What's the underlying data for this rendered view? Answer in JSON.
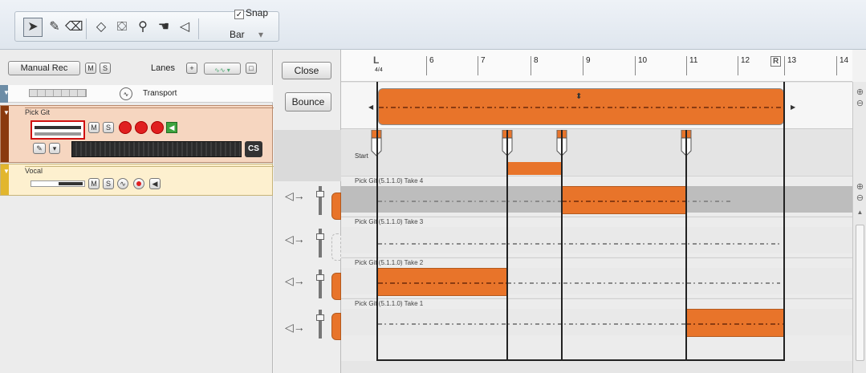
{
  "toolbar": {
    "tools": [
      "arrow-tool-icon",
      "pencil-tool-icon",
      "eraser-tool-icon",
      "split-tool-icon",
      "comp-tool-icon",
      "zoom-tool-icon",
      "hand-tool-icon",
      "speaker-tool-icon"
    ],
    "snap_checked": true,
    "snap_label": "Snap",
    "snap_mode": "Bar"
  },
  "track_header": {
    "manual_rec": "Manual Rec",
    "m": "M",
    "s": "S",
    "lanes_label": "Lanes",
    "cs": "CS"
  },
  "tracks": [
    {
      "name": "Transport"
    },
    {
      "name": "Pick Git"
    },
    {
      "name": "Vocal"
    }
  ],
  "lane_strip": {
    "close": "Close",
    "bounce": "Bounce"
  },
  "ruler": {
    "bars": [
      "6",
      "7",
      "8",
      "9",
      "10",
      "11",
      "12",
      "13",
      "14"
    ],
    "left_locator": "L",
    "right_locator": "R",
    "time_sig": "4/4"
  },
  "markers": {
    "start_label": "Start"
  },
  "lanes": [
    {
      "label": "Pick Git (5.1.1.0) Take 4"
    },
    {
      "label": "Pick Git (5.1.1.0) Take 3"
    },
    {
      "label": "Pick Git (5.1.1.0) Take 2"
    },
    {
      "label": "Pick Git (5.1.1.0) Take 1"
    }
  ],
  "colors": {
    "clip": "#e8742a",
    "track_pick": "#f6d6c0",
    "track_vocal": "#fdf0cf",
    "accent_selected": "#d01010"
  }
}
